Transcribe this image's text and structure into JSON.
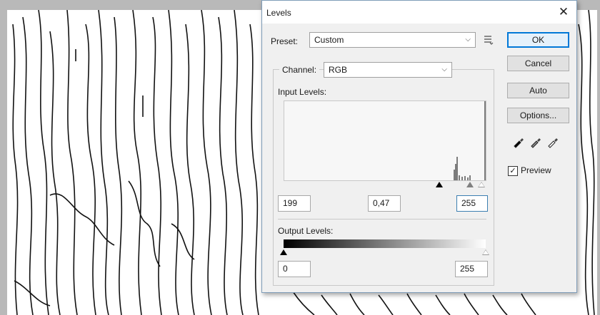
{
  "dialog": {
    "title": "Levels",
    "preset_label": "Preset:",
    "preset_value": "Custom",
    "channel_label": "Channel:",
    "channel_value": "RGB",
    "input_levels_label": "Input Levels:",
    "input_black": "199",
    "input_gamma": "0,47",
    "input_white": "255",
    "output_levels_label": "Output Levels:",
    "output_black": "0",
    "output_white": "255",
    "buttons": {
      "ok": "OK",
      "cancel": "Cancel",
      "auto": "Auto",
      "options": "Options..."
    },
    "preview_label": "Preview",
    "preview_checked": true
  },
  "icons": {
    "close": "close-icon",
    "preset_menu": "preset-options-icon",
    "eyedroppers": [
      "black-eyedropper-icon",
      "gray-eyedropper-icon",
      "white-eyedropper-icon"
    ]
  },
  "colors": {
    "default_button_border": "#0078d7",
    "dialog_bg": "#f0f0f0",
    "canvas_bg": "#ffffff"
  }
}
